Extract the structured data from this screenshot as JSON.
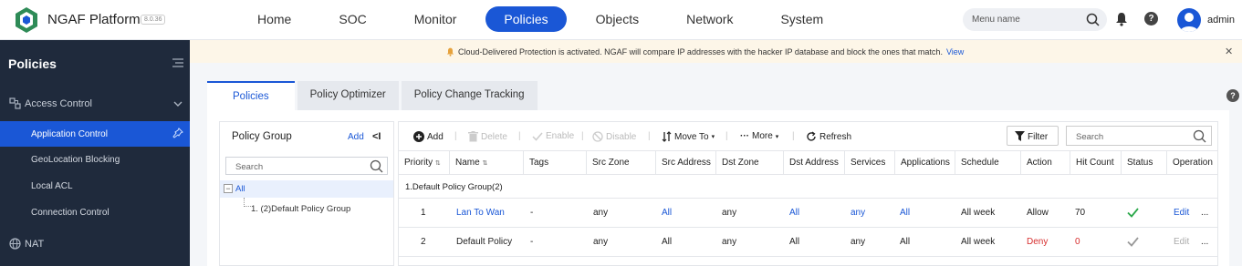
{
  "app": {
    "name": "NGAF Platform",
    "version": "8.0.36"
  },
  "nav": {
    "items": [
      "Home",
      "SOC",
      "Monitor",
      "Policies",
      "Objects",
      "Network",
      "System"
    ],
    "active": "Policies"
  },
  "header": {
    "menu_search_placeholder": "Menu name",
    "user": "admin",
    "help": "?"
  },
  "sidebar": {
    "title": "Policies",
    "group1": {
      "label": "Access Control",
      "icon": "access-control-icon"
    },
    "items": [
      {
        "label": "Application Control",
        "active": true
      },
      {
        "label": "GeoLocation Blocking",
        "active": false
      },
      {
        "label": "Local ACL",
        "active": false
      },
      {
        "label": "Connection Control",
        "active": false
      }
    ],
    "group2": {
      "label": "NAT",
      "icon": "globe-icon"
    }
  },
  "banner": {
    "message": "Cloud-Delivered Protection is activated. NGAF will compare IP addresses with the hacker IP database and block the ones that match.",
    "link": "View"
  },
  "tabs": [
    "Policies",
    "Policy Optimizer",
    "Policy Change Tracking"
  ],
  "policy_group": {
    "title": "Policy Group",
    "add": "Add",
    "collapse": "<I",
    "search_placeholder": "Search",
    "tree": {
      "root": "All",
      "child": "1. (2)Default Policy Group"
    }
  },
  "toolbar": {
    "add": "Add",
    "delete": "Delete",
    "enable": "Enable",
    "disable": "Disable",
    "move_to": "Move To",
    "more": "More",
    "refresh": "Refresh",
    "filter": "Filter",
    "search_placeholder": "Search"
  },
  "table": {
    "columns": [
      "Priority",
      "Name",
      "Tags",
      "Src Zone",
      "Src Address",
      "Dst Zone",
      "Dst Address",
      "Services",
      "Applications",
      "Schedule",
      "Action",
      "Hit Count",
      "Status",
      "Operation"
    ],
    "group_label": "1.Default Policy Group(2)",
    "rows": [
      {
        "priority": "1",
        "name": "Lan To Wan",
        "tags": "-",
        "src_zone": "any",
        "src_address": "All",
        "dst_zone": "any",
        "dst_address": "All",
        "services": "any",
        "applications": "All",
        "schedule": "All week",
        "action": "Allow",
        "hit_count": "70",
        "status": "enabled",
        "operation": "Edit",
        "more": "..."
      },
      {
        "priority": "2",
        "name": "Default Policy",
        "tags": "-",
        "src_zone": "any",
        "src_address": "All",
        "dst_zone": "any",
        "dst_address": "All",
        "services": "any",
        "applications": "All",
        "schedule": "All week",
        "action": "Deny",
        "hit_count": "0",
        "status": "enabled-default",
        "operation": "Edit",
        "more": "..."
      }
    ]
  },
  "colors": {
    "accent": "#1a57d6",
    "sidebar_bg": "#1f2a3c",
    "deny": "#d62d2d",
    "status_ok": "#2aa84a"
  }
}
